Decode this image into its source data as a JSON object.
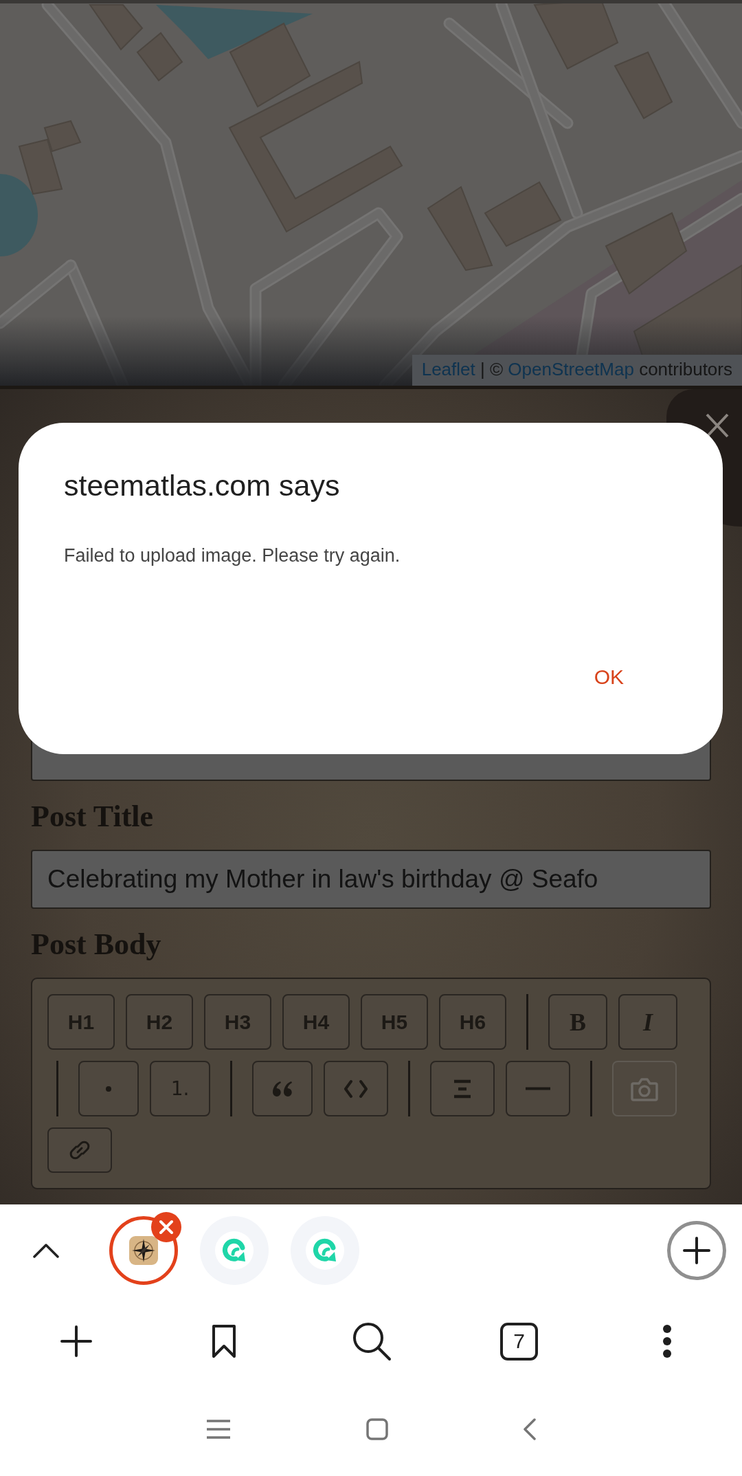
{
  "map": {
    "attribution": [
      {
        "kind": "link",
        "text": "Leaflet"
      },
      {
        "kind": "plain",
        "text": " | © "
      },
      {
        "kind": "link",
        "text": "OpenStreetMap"
      },
      {
        "kind": "plain",
        "text": " contributors"
      }
    ]
  },
  "fields": [
    {
      "label": "Post Title",
      "value": "Celebrating my Mother in law's birthday @ Seafo"
    }
  ],
  "body": {
    "label": "Post Body",
    "toolbar": [
      [
        {
          "kind": "heading",
          "label": "H1",
          "divider_before": false,
          "disabled": false
        },
        {
          "kind": "heading",
          "label": "H2",
          "divider_before": false,
          "disabled": false
        },
        {
          "kind": "heading",
          "label": "H3",
          "divider_before": false,
          "disabled": false
        },
        {
          "kind": "heading",
          "label": "H4",
          "divider_before": false,
          "disabled": false
        },
        {
          "kind": "heading",
          "label": "H5",
          "divider_before": false,
          "disabled": false
        },
        {
          "kind": "heading",
          "label": "H6",
          "divider_before": false,
          "disabled": false
        },
        {
          "kind": "bold",
          "label": "B",
          "divider_before": true,
          "disabled": false
        },
        {
          "kind": "italic",
          "label": "I",
          "divider_before": false,
          "disabled": false
        }
      ],
      [
        {
          "kind": "bullet",
          "divider_before": true,
          "disabled": false
        },
        {
          "kind": "ordered",
          "label": "1.",
          "divider_before": false,
          "disabled": false
        },
        {
          "kind": "quote",
          "divider_before": true,
          "disabled": false
        },
        {
          "kind": "code",
          "divider_before": false,
          "disabled": false
        },
        {
          "kind": "align",
          "divider_before": true,
          "disabled": false
        },
        {
          "kind": "rule",
          "divider_before": false,
          "disabled": false
        },
        {
          "kind": "image",
          "divider_before": true,
          "disabled": true
        }
      ],
      [
        {
          "kind": "link",
          "divider_before": false,
          "disabled": false
        }
      ]
    ]
  },
  "dialog": {
    "title": "steematlas.com says",
    "message": "Failed to upload image. Please try again.",
    "button": "OK"
  },
  "browser": {
    "tabs": [
      {
        "kind": "compass",
        "selected": true
      },
      {
        "kind": "chat",
        "selected": false
      },
      {
        "kind": "chat",
        "selected": false
      }
    ],
    "tab_count": "7"
  }
}
